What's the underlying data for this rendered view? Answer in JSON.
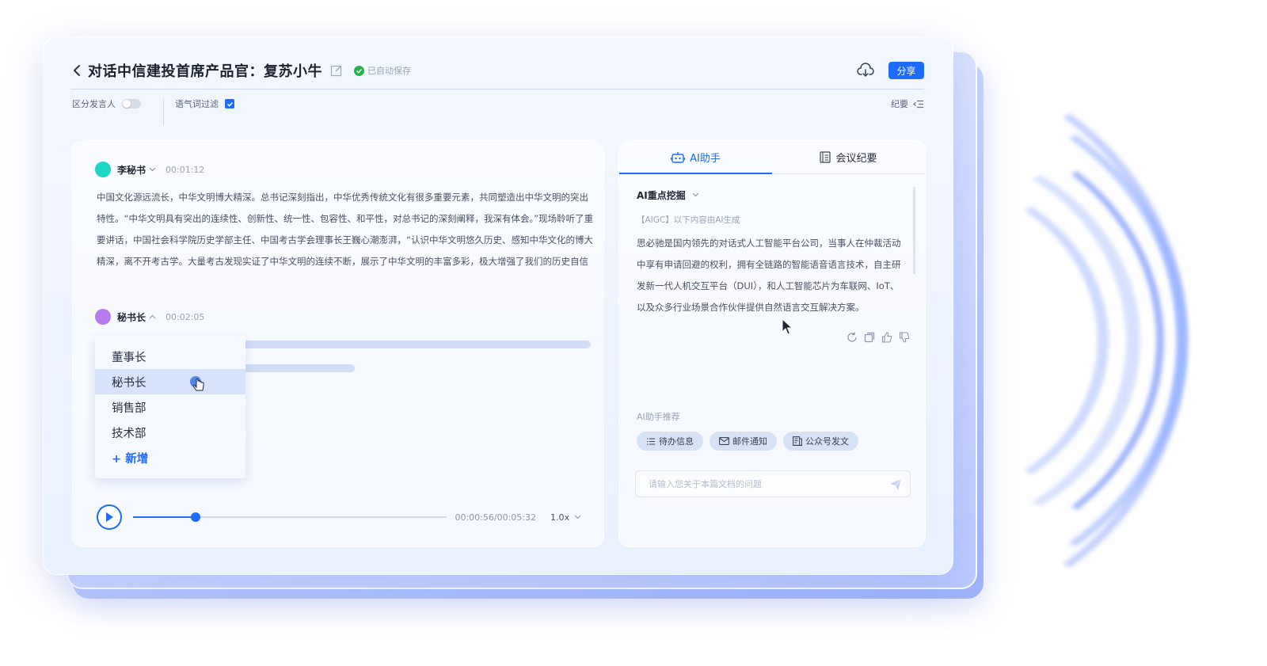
{
  "header": {
    "title": "对话中信建投首席产品官：复苏小牛",
    "saved_status": "已自动保存",
    "share_label": "分享"
  },
  "options": {
    "distinguish_speaker_label": "区分发言人",
    "distinguish_speaker_on": false,
    "filler_filter_label": "语气词过滤",
    "filler_filter_on": true,
    "summary_label": "纪要"
  },
  "transcript": {
    "entries": [
      {
        "speaker": "李秘书",
        "time": "00:01:12",
        "avatar_color": "#1fd6c4",
        "text": "中国文化源远流长，中华文明博大精深。总书记深刻指出，中华优秀传统文化有很多重要元素，共同塑造出中华文明的突出特性。“中华文明具有突出的连续性、创新性、统一性、包容性、和平性，对总书记的深刻阐释，我深有体会。”现场聆听了重要讲话，中国社会科学院历史学部主任、中国考古学会理事长王巍心潮澎湃，“认识中华文明悠久历史、感知中华文化的博大精深，离不开考古学。大量考古发现实证了中华文明的连续不断，展示了中华文明的丰富多彩，极大增强了我们的历史自信"
      },
      {
        "speaker": "秘书长",
        "time": "00:02:05",
        "avatar_color": "#b57cf0",
        "text": ""
      }
    ],
    "dropdown": {
      "options": [
        "董事长",
        "秘书长",
        "销售部",
        "技术部"
      ],
      "selected_index": 1,
      "add_label": "+ 新增"
    },
    "player": {
      "current": "00:00:56",
      "total": "00:05:32",
      "time_display": "00:00:56/00:05:32",
      "progress": 0.2,
      "speed": "1.0x"
    }
  },
  "ai_panel": {
    "tabs": [
      {
        "label": "AI助手",
        "active": true
      },
      {
        "label": "会议纪要",
        "active": false
      }
    ],
    "section_title": "AI重点挖掘",
    "aigc_note": "【AIGC】以下内容由AI生成",
    "content": "思必驰是国内领先的对话式人工智能平台公司，当事人在仲裁活动中享有申请回避的权利，拥有全链路的智能语音语言技术，自主研发新一代人机交互平台（DUI），和人工智能芯片为车联网、IoT、以及众多行业场景合作伙伴提供自然语言交互解决方案。",
    "recommend_label": "AI助手推荐",
    "chips": [
      "待办信息",
      "邮件通知",
      "公众号发文"
    ],
    "input_placeholder": "请输入您关于本篇文档的问题"
  },
  "colors": {
    "accent": "#1e6bff",
    "saved_green": "#22b34a"
  }
}
